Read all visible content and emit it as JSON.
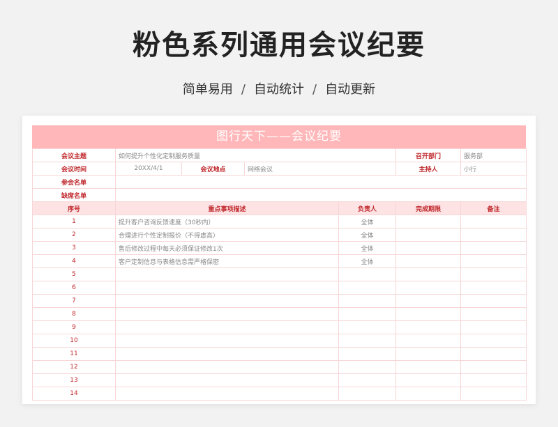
{
  "header": {
    "title": "粉色系列通用会议纪要",
    "tags": [
      "简单易用",
      "自动统计",
      "自动更新"
    ],
    "separator": "/"
  },
  "sheet": {
    "title": "图行天下——会议纪要",
    "info": {
      "topic_label": "会议主题",
      "topic_value": "如何提升个性化定制服务质量",
      "dept_label": "召开部门",
      "dept_value": "服务部",
      "time_label": "会议时间",
      "time_value": "20XX/4/1",
      "place_label": "会议地点",
      "place_value": "网络会议",
      "host_label": "主持人",
      "host_value": "小行",
      "attendees_label": "参会名单",
      "attendees_value": "",
      "absentees_label": "缺席名单",
      "absentees_value": ""
    },
    "columns": [
      "序号",
      "重点事项描述",
      "负责人",
      "完成期限",
      "备注"
    ],
    "rows": [
      {
        "no": "1",
        "desc": "提升客户咨询反馈速度（30秒内）",
        "owner": "全体",
        "deadline": "",
        "note": ""
      },
      {
        "no": "2",
        "desc": "合理进行个性定制报价（不得虚高）",
        "owner": "全体",
        "deadline": "",
        "note": ""
      },
      {
        "no": "3",
        "desc": "售后修改过程中每天必须保证修改1次",
        "owner": "全体",
        "deadline": "",
        "note": ""
      },
      {
        "no": "4",
        "desc": "客户定制信息与表格信息需严格保密",
        "owner": "全体",
        "deadline": "",
        "note": ""
      },
      {
        "no": "5",
        "desc": "",
        "owner": "",
        "deadline": "",
        "note": ""
      },
      {
        "no": "6",
        "desc": "",
        "owner": "",
        "deadline": "",
        "note": ""
      },
      {
        "no": "7",
        "desc": "",
        "owner": "",
        "deadline": "",
        "note": ""
      },
      {
        "no": "8",
        "desc": "",
        "owner": "",
        "deadline": "",
        "note": ""
      },
      {
        "no": "9",
        "desc": "",
        "owner": "",
        "deadline": "",
        "note": ""
      },
      {
        "no": "10",
        "desc": "",
        "owner": "",
        "deadline": "",
        "note": ""
      },
      {
        "no": "11",
        "desc": "",
        "owner": "",
        "deadline": "",
        "note": ""
      },
      {
        "no": "12",
        "desc": "",
        "owner": "",
        "deadline": "",
        "note": ""
      },
      {
        "no": "13",
        "desc": "",
        "owner": "",
        "deadline": "",
        "note": ""
      },
      {
        "no": "14",
        "desc": "",
        "owner": "",
        "deadline": "",
        "note": ""
      }
    ]
  }
}
